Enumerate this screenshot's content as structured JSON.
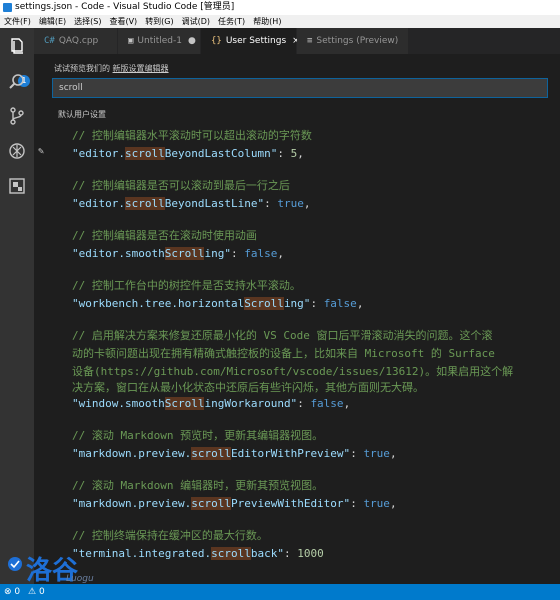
{
  "titlebar": {
    "title": "settings.json - Code - Visual Studio Code [管理员]"
  },
  "menubar": {
    "items": [
      "文件(F)",
      "编辑(E)",
      "选择(S)",
      "查看(V)",
      "转到(G)",
      "调试(D)",
      "任务(T)",
      "帮助(H)"
    ]
  },
  "activitybar": {
    "badge": "1"
  },
  "tabs": [
    {
      "icon": "C#",
      "label": "QAQ.cpp",
      "close": ""
    },
    {
      "icon": "▣",
      "label": "Untitled-1",
      "close": "●"
    },
    {
      "icon": "{}",
      "label": "User Settings",
      "close": "×"
    },
    {
      "icon": "≡",
      "label": "Settings (Preview)",
      "close": ""
    }
  ],
  "settings": {
    "preview_prefix": "试试预览我们的 ",
    "preview_link": "新版设置编辑器",
    "search_value": "scroll",
    "section_label": "默认用户设置"
  },
  "code": {
    "c1": "// 控制编辑器水平滚动时可以超出滚动的字符数",
    "s1a": "\"editor.",
    "s1h": "scroll",
    "s1b": "BeyondLastColumn\"",
    "p1": ": ",
    "v1": "5",
    "e1": ",",
    "c2": "// 控制编辑器是否可以滚动到最后一行之后",
    "s2a": "\"editor.",
    "s2h": "scroll",
    "s2b": "BeyondLastLine\"",
    "p2": ": ",
    "v2": "true",
    "e2": ",",
    "c3": "// 控制编辑器是否在滚动时使用动画",
    "s3a": "\"editor.smooth",
    "s3h": "Scroll",
    "s3b": "ing\"",
    "p3": ": ",
    "v3": "false",
    "e3": ",",
    "c4": "// 控制工作台中的树控件是否支持水平滚动。",
    "s4a": "\"workbench.tree.horizontal",
    "s4h": "Scroll",
    "s4b": "ing\"",
    "p4": ": ",
    "v4": "false",
    "e4": ",",
    "c5a": "// 启用解决方案来修复还原最小化的 VS Code 窗口后平滑滚动消失的问题。这个滚",
    "c5b": "动的卡顿问题出现在拥有精确式触控板的设备上，比如来自 Microsoft 的 Surface",
    "c5c": "设备(https://github.com/Microsoft/vscode/issues/13612)。如果启用这个解",
    "c5d": "决方案，窗口在从最小化状态中还原后有些许闪烁，其他方面则无大碍。",
    "s5a": "\"window.smooth",
    "s5h": "Scroll",
    "s5b": "ingWorkaround\"",
    "p5": ": ",
    "v5": "false",
    "e5": ",",
    "c6": "// 滚动 Markdown 预览时，更新其编辑器视图。",
    "s6a": "\"markdown.preview.",
    "s6h": "scroll",
    "s6b": "EditorWithPreview\"",
    "p6": ": ",
    "v6": "true",
    "e6": ",",
    "c7": "// 滚动 Markdown 编辑器时，更新其预览视图。",
    "s7a": "\"markdown.preview.",
    "s7h": "scroll",
    "s7b": "PreviewWithEditor\"",
    "p7": ": ",
    "v7": "true",
    "e7": ",",
    "c8": "// 控制终端保持在缓冲区的最大行数。",
    "s8a": "\"terminal.integrated.",
    "s8h": "scroll",
    "s8b": "back\"",
    "p8": ": ",
    "v8": "1000",
    "e8": ""
  },
  "watermark": {
    "text": "洛谷",
    "sub": "Luogu"
  },
  "statusbar": {
    "errors": "0",
    "warnings": "0"
  },
  "colors": {
    "accent": "#007acc",
    "highlight": "#5a3520",
    "comment": "#6a9955",
    "string": "#9cdcfe"
  }
}
